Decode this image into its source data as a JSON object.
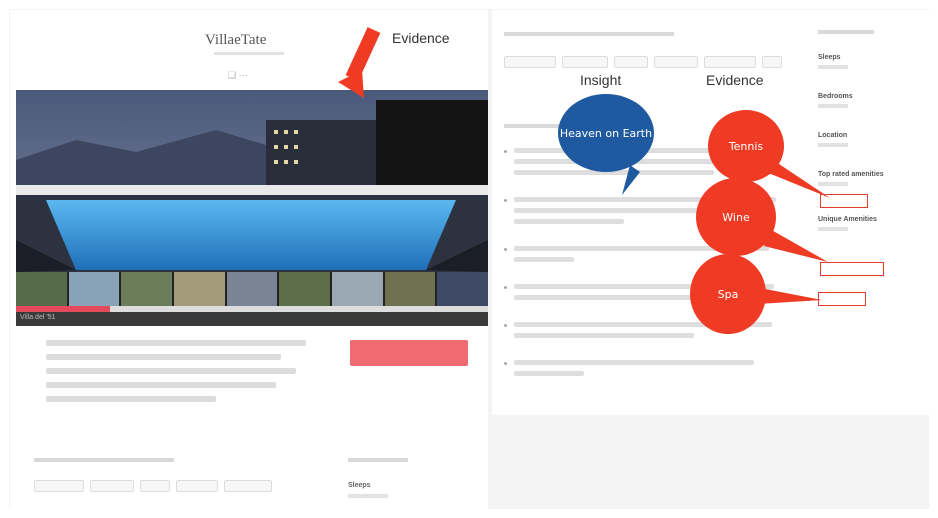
{
  "site": {
    "logo": "VillaeTate",
    "header_control": "❏ ···"
  },
  "hero": {
    "caption": "Villa del '51",
    "progress": 0.2
  },
  "annotations": {
    "evidence_top": "Evidence",
    "insight": "Insight",
    "evidence_right": "Evidence",
    "bubble_heaven": "Heaven on Earth",
    "bubble_tennis": "Tennis",
    "bubble_wine": "Wine",
    "bubble_spa": "Spa"
  },
  "sidebar": {
    "labels": [
      "Sleeps",
      "Bedrooms",
      "Location",
      "Top rated amenities",
      "Unique Amenities"
    ]
  },
  "lower": {
    "side_label": "Sleeps"
  },
  "colors": {
    "accent": "#ef3a24",
    "insight": "#1f5aa0",
    "button": "#f06a72",
    "pool": "#3b9fe0"
  }
}
